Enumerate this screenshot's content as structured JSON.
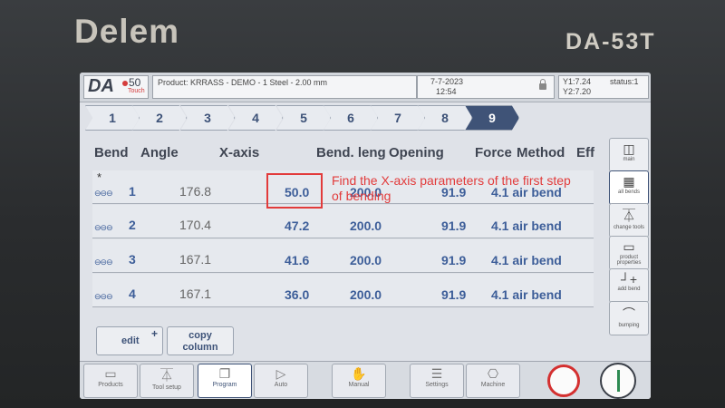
{
  "brand": "Delem",
  "model": "DA-53T",
  "header": {
    "logo_da": "DA",
    "logo_num": "50",
    "logo_touch": "Touch",
    "product": "Product: KRRASS - DEMO - 1 Steel - 2.00 mm",
    "date": "7-7-2023",
    "time": "12:54",
    "y1": "Y1:7.24",
    "y2": "Y2:7.20",
    "status": "status:1"
  },
  "tabs": [
    "1",
    "2",
    "3",
    "4",
    "5",
    "6",
    "7",
    "8",
    "9"
  ],
  "active_tab": "9",
  "columns": {
    "bend": "Bend",
    "angle": "Angle",
    "xaxis": "X-axis",
    "bend_length": "Bend. leng",
    "opening": "Opening",
    "force": "Force",
    "method": "Method",
    "eff": "Eff"
  },
  "rows": [
    {
      "bend": "1",
      "angle": "176.8",
      "xaxis": "50.0",
      "bend_length": "200.0",
      "opening": "91.9",
      "method": "4.1 air bend",
      "starred": "*",
      "chain": "⊖⊖⊖"
    },
    {
      "bend": "2",
      "angle": "170.4",
      "xaxis": "47.2",
      "bend_length": "200.0",
      "opening": "91.9",
      "method": "4.1 air bend",
      "starred": "",
      "chain": "⊖⊖⊖"
    },
    {
      "bend": "3",
      "angle": "167.1",
      "xaxis": "41.6",
      "bend_length": "200.0",
      "opening": "91.9",
      "method": "4.1 air bend",
      "starred": "",
      "chain": "⊖⊖⊖"
    },
    {
      "bend": "4",
      "angle": "167.1",
      "xaxis": "36.0",
      "bend_length": "200.0",
      "opening": "91.9",
      "method": "4.1 air bend",
      "starred": "",
      "chain": "⊖⊖⊖"
    }
  ],
  "annotation": "Find the X-axis parameters of the first step of bending",
  "sidebar": [
    {
      "icon": "◫",
      "label": "main"
    },
    {
      "icon": "▦",
      "label": "all bends"
    },
    {
      "icon": "⏄",
      "label": "change tools"
    },
    {
      "icon": "▭",
      "label": "product properties"
    },
    {
      "icon": "┘+",
      "label": "add bend"
    },
    {
      "icon": "⌒",
      "label": "bumping"
    }
  ],
  "actions": {
    "edit": "edit",
    "edit_plus": "+",
    "copy_column": "copy column"
  },
  "bottom": [
    {
      "icon": "▭",
      "label": "Products"
    },
    {
      "icon": "⏄",
      "label": "Tool setup"
    },
    {
      "icon": "❐",
      "label": "Program"
    },
    {
      "icon": "▷",
      "label": "Auto"
    },
    {
      "icon": "✋",
      "label": "Manual"
    },
    {
      "icon": "☰",
      "label": "Settings"
    },
    {
      "icon": "⎔",
      "label": "Machine"
    }
  ],
  "colors": {
    "annotation": "#e23b3b",
    "accent": "#3f5377",
    "value_blue": "#3d5e99"
  }
}
